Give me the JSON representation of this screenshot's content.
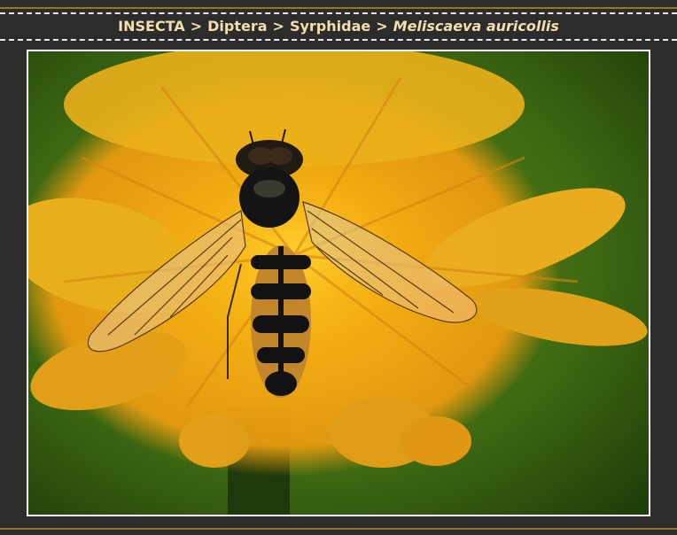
{
  "breadcrumb": {
    "class": "INSECTA",
    "order": "Diptera",
    "family": "Syrphidae",
    "species": "Meliscaeva auricollis",
    "separator": ">"
  },
  "colors": {
    "background": "#2c2c2c",
    "breadcrumb_text": "#f3dfae",
    "accent_line": "#8a7a2a",
    "photo_border": "#ffffff"
  }
}
